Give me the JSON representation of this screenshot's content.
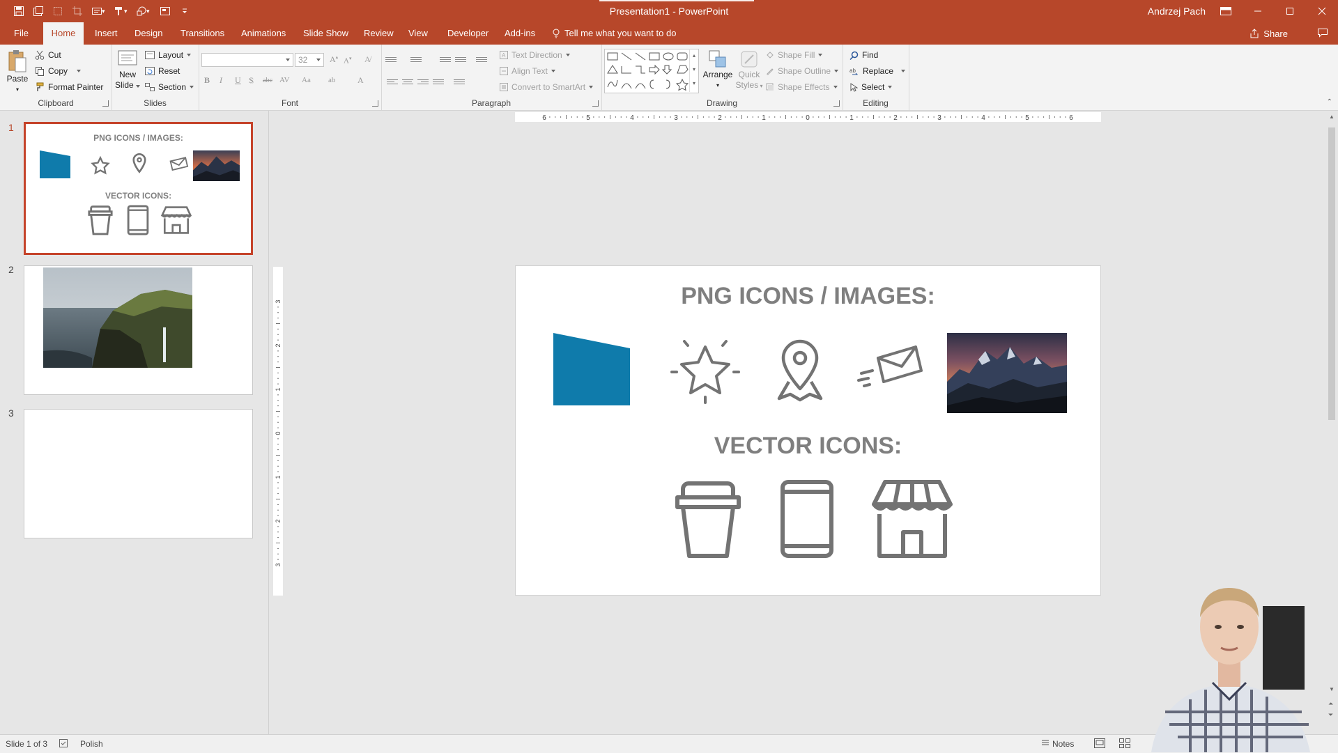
{
  "window": {
    "title": "Presentation1  -  PowerPoint",
    "user": "Andrzej Pach",
    "accent": "#b7472a"
  },
  "quick_access": [
    "save-icon",
    "autosave-icon",
    "screenshot-icon",
    "crop-icon",
    "layout-icon",
    "format-icon",
    "shapes-icon",
    "placeholder-icon",
    "customize-icon"
  ],
  "tabs": {
    "file": "File",
    "home": "Home",
    "insert": "Insert",
    "design": "Design",
    "transitions": "Transitions",
    "animations": "Animations",
    "slideshow": "Slide Show",
    "review": "Review",
    "view": "View",
    "developer": "Developer",
    "addins": "Add-ins",
    "tell_me": "Tell me what you want to do",
    "share": "Share"
  },
  "ribbon": {
    "clipboard": {
      "label": "Clipboard",
      "paste": "Paste",
      "cut": "Cut",
      "copy": "Copy",
      "format_painter": "Format Painter"
    },
    "slides": {
      "label": "Slides",
      "new_slide_1": "New",
      "new_slide_2": "Slide",
      "layout": "Layout",
      "reset": "Reset",
      "section": "Section"
    },
    "font": {
      "label": "Font",
      "font_name": "",
      "font_size": "32"
    },
    "paragraph": {
      "label": "Paragraph",
      "text_direction": "Text Direction",
      "align_text": "Align Text",
      "convert_smartart": "Convert to SmartArt"
    },
    "drawing": {
      "label": "Drawing",
      "arrange": "Arrange",
      "quick_1": "Quick",
      "quick_2": "Styles",
      "shape_fill": "Shape Fill",
      "shape_outline": "Shape Outline",
      "shape_effects": "Shape Effects"
    },
    "editing": {
      "label": "Editing",
      "find": "Find",
      "replace": "Replace",
      "select": "Select"
    }
  },
  "thumbnails": [
    {
      "number": "1",
      "png_heading": "PNG ICONS / IMAGES:",
      "vector_heading": "VECTOR ICONS:"
    },
    {
      "number": "2"
    },
    {
      "number": "3"
    }
  ],
  "slide": {
    "png_heading": "PNG ICONS / IMAGES:",
    "vector_heading": "VECTOR ICONS:",
    "png_items": [
      "blue-shape",
      "star-icon",
      "location-pin-icon",
      "envelope-icon",
      "mountain-photo"
    ],
    "vector_items": [
      "coffee-cup-icon",
      "tablet-icon",
      "store-icon"
    ],
    "blue_color": "#0f7bab",
    "icon_color": "#737373"
  },
  "rulers": {
    "horizontal": [
      "6",
      "5",
      "4",
      "3",
      "2",
      "1",
      "0",
      "1",
      "2",
      "3",
      "4",
      "5",
      "6"
    ],
    "vertical": [
      "3",
      "2",
      "1",
      "0",
      "1",
      "2",
      "3"
    ]
  },
  "status": {
    "slide_info": "Slide 1 of 3",
    "language": "Polish",
    "notes": "Notes"
  }
}
